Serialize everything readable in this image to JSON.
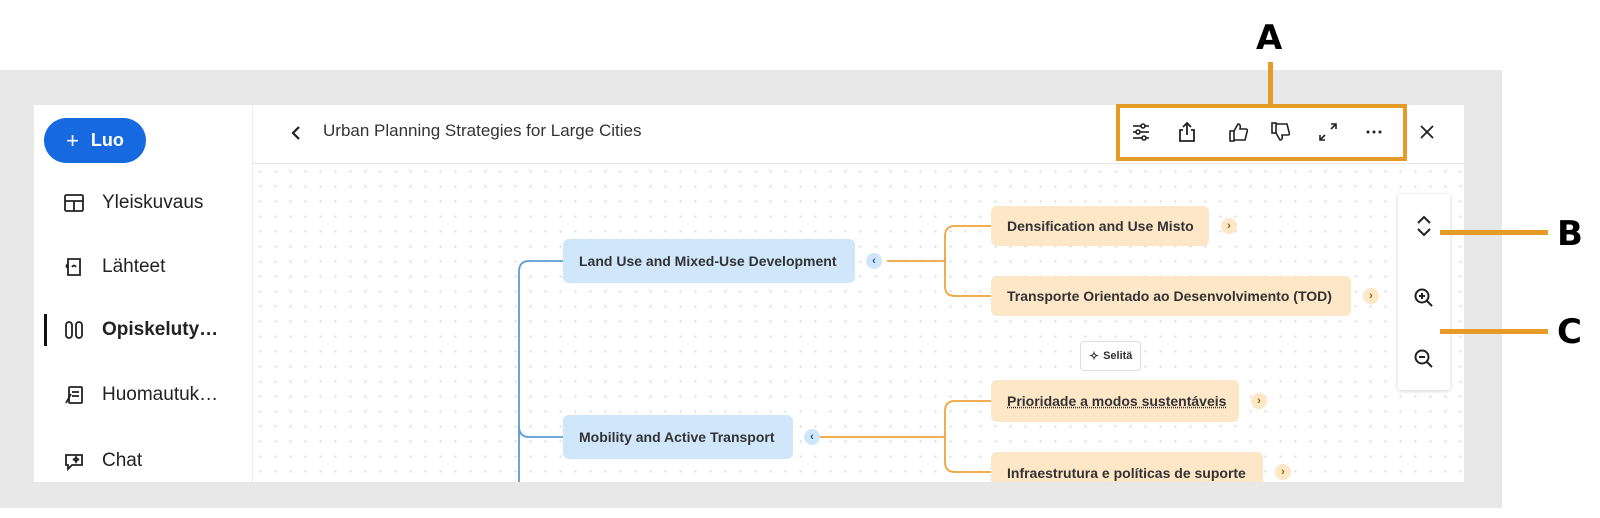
{
  "sidebar": {
    "create_label": "Luo",
    "items": [
      {
        "label": "Yleiskuvaus",
        "icon": "layout-icon"
      },
      {
        "label": "Lähteet",
        "icon": "sources-icon"
      },
      {
        "label": "Opiskeluty…",
        "icon": "study-tools-icon",
        "active": true
      },
      {
        "label": "Huomautuk…",
        "icon": "notes-icon"
      },
      {
        "label": "Chat",
        "icon": "chat-icon"
      }
    ]
  },
  "header": {
    "title": "Urban Planning Strategies for Large Cities",
    "toolbar": [
      "settings-sliders-icon",
      "share-icon",
      "thumbs-up-icon",
      "thumbs-down-icon",
      "expand-icon",
      "more-icon",
      "close-icon"
    ]
  },
  "mindmap": {
    "branches": [
      {
        "label": "Land Use and Mixed-Use Development",
        "toggle": "‹",
        "children": [
          {
            "label": "Densification and Use Misto",
            "toggle": "›"
          },
          {
            "label": "Transporte Orientado ao Desenvolvimento (TOD)",
            "toggle": "›"
          }
        ]
      },
      {
        "label": "Mobility and Active Transport",
        "toggle": "‹",
        "children": [
          {
            "label": "Prioridade a modos sustentáveis",
            "toggle": "›"
          },
          {
            "label": "Infraestrutura e políticas de suporte",
            "toggle": "›"
          }
        ]
      }
    ],
    "explain_label": "Selitä"
  },
  "zoom_controls": [
    "expand-collapse-icon",
    "zoom-in-icon",
    "zoom-out-icon"
  ],
  "callouts": {
    "a": "A",
    "b": "B",
    "c": "C"
  },
  "colors": {
    "primary": "#1769e0",
    "branch_blue": "#cfe6fb",
    "branch_orange": "#fde7c7",
    "callout": "#e59b26"
  }
}
